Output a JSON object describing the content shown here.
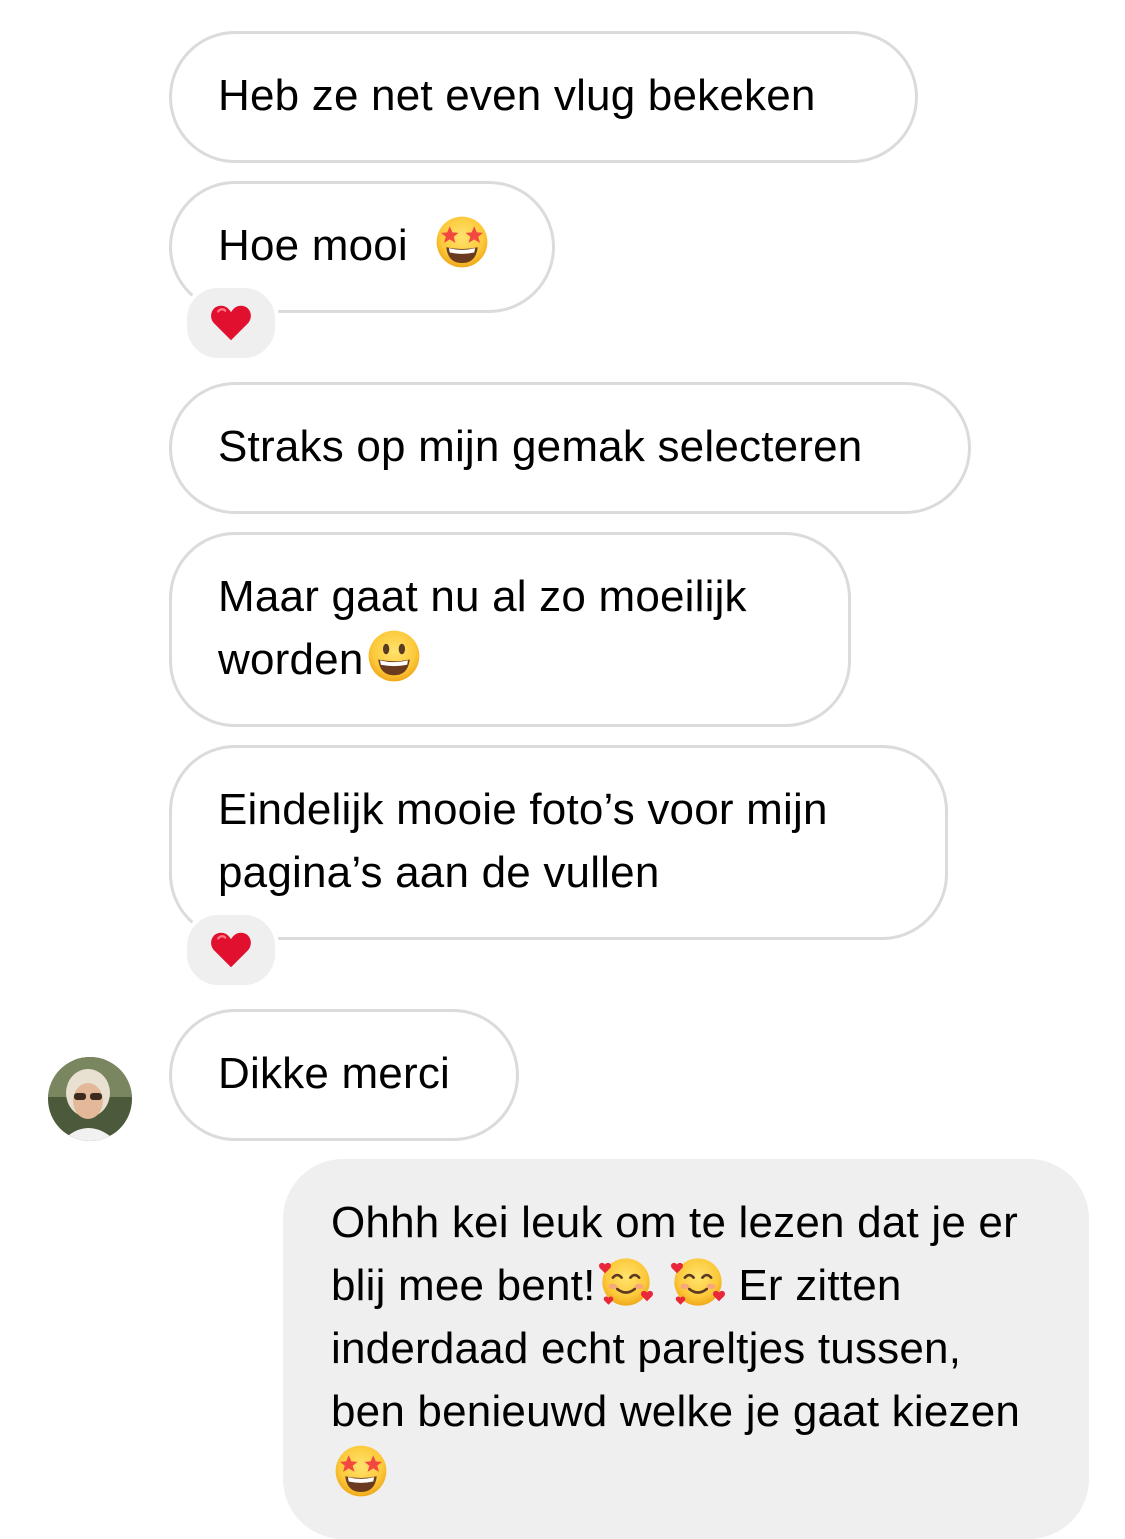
{
  "thread": {
    "messages": [
      {
        "id": "m1",
        "text": "Heb ze net even vlug bekeken",
        "emoji": ""
      },
      {
        "id": "m2",
        "text": "Hoe mooi",
        "emoji": "star-struck",
        "reaction": "heart"
      },
      {
        "id": "m3",
        "text": "Straks op mijn gemak selecteren",
        "emoji": ""
      },
      {
        "id": "m4",
        "text": "Maar gaat nu al zo moeilijk worden",
        "emoji": "grinning-face"
      },
      {
        "id": "m5",
        "text": "Eindelijk mooie foto’s voor mijn pagina’s aan de vullen",
        "emoji": "",
        "reaction": "heart"
      },
      {
        "id": "m6",
        "text": "Dikke merci",
        "emoji": ""
      }
    ],
    "reply": {
      "part1": "Ohhh kei leuk om te lezen dat je er blij mee bent!",
      "part1_emoji": [
        "smiling-face-with-hearts",
        "smiling-face-with-hearts"
      ],
      "part2": " Er zitten inderdaad echt pareltjes tussen, ben benieuwd welke je gaat kiezen",
      "part2_emoji": "star-struck"
    }
  },
  "colors": {
    "incoming_border": "#dbdbdb",
    "outgoing_background": "#efefef",
    "reaction_background": "#efefef",
    "heart": "#e0102e",
    "emoji_yellow": "#ffcc33"
  }
}
